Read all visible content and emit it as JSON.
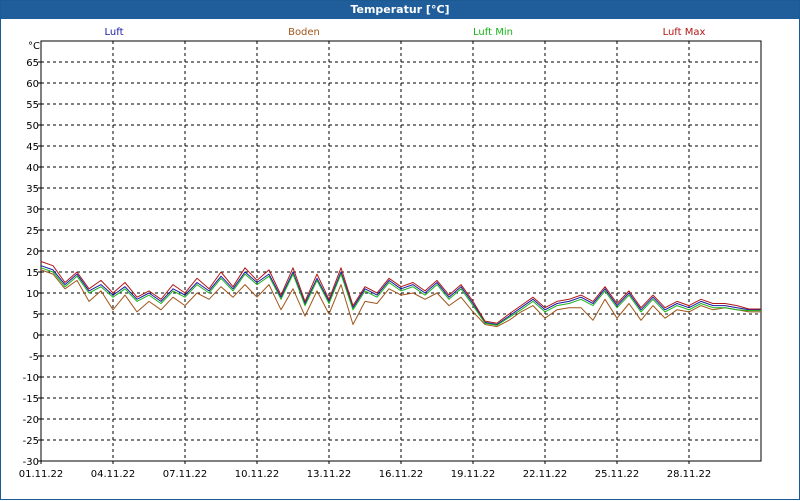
{
  "window": {
    "title": "Temperatur [°C]"
  },
  "chart_data": {
    "type": "line",
    "title": "Temperatur [°C]",
    "ylabel": "°C",
    "xlabel": "",
    "ylim": [
      -30,
      70
    ],
    "yticks": [
      65,
      60,
      55,
      50,
      45,
      40,
      35,
      30,
      25,
      20,
      15,
      10,
      5,
      0,
      -5,
      -10,
      -15,
      -20,
      -25,
      -30
    ],
    "x_tick_labels": [
      "01.11.22",
      "04.11.22",
      "07.11.22",
      "10.11.22",
      "13.11.22",
      "16.11.22",
      "19.11.22",
      "22.11.22",
      "25.11.22",
      "28.11.22"
    ],
    "x_tick_days": [
      0,
      3,
      6,
      9,
      12,
      15,
      18,
      21,
      24,
      27
    ],
    "x_range_days": [
      0,
      30
    ],
    "grid": true,
    "legend_placement": "top",
    "days": [
      0,
      0.5,
      1,
      1.5,
      2,
      2.5,
      3,
      3.5,
      4,
      4.5,
      5,
      5.5,
      6,
      6.5,
      7,
      7.5,
      8,
      8.5,
      9,
      9.5,
      10,
      10.5,
      11,
      11.5,
      12,
      12.5,
      13,
      13.5,
      14,
      14.5,
      15,
      15.5,
      16,
      16.5,
      17,
      17.5,
      18,
      18.5,
      19,
      19.5,
      20,
      20.5,
      21,
      21.5,
      22,
      22.5,
      23,
      23.5,
      24,
      24.5,
      25,
      25.5,
      26,
      26.5,
      27,
      27.5,
      28,
      28.5,
      29,
      29.5,
      30
    ],
    "series": [
      {
        "name": "Luft",
        "color": "#1a1aa8",
        "values": [
          16.5,
          15.5,
          12.0,
          14.5,
          10.5,
          12.0,
          9.5,
          11.5,
          8.5,
          10.0,
          8.0,
          11.0,
          9.5,
          12.5,
          10.5,
          14.0,
          11.0,
          15.0,
          12.5,
          14.5,
          9.0,
          15.0,
          7.5,
          13.5,
          8.0,
          15.0,
          6.5,
          11.0,
          9.5,
          13.0,
          11.0,
          12.0,
          10.0,
          12.5,
          9.0,
          11.5,
          7.5,
          3.0,
          2.5,
          4.5,
          6.5,
          8.5,
          6.0,
          7.5,
          8.0,
          9.0,
          7.5,
          11.0,
          7.0,
          10.0,
          6.0,
          9.0,
          6.0,
          7.5,
          6.5,
          8.0,
          7.0,
          7.0,
          6.5,
          6.0,
          6.0
        ]
      },
      {
        "name": "Boden",
        "color": "#a0561c",
        "values": [
          15.5,
          14.5,
          11.0,
          13.0,
          8.0,
          10.5,
          6.0,
          9.5,
          5.5,
          8.0,
          6.0,
          9.0,
          7.0,
          10.0,
          8.5,
          11.5,
          9.0,
          12.0,
          9.0,
          12.0,
          6.0,
          11.0,
          4.5,
          10.5,
          5.0,
          12.0,
          2.5,
          8.0,
          7.5,
          11.0,
          9.5,
          10.0,
          8.5,
          10.0,
          7.0,
          9.0,
          5.5,
          2.5,
          2.0,
          3.5,
          5.5,
          7.0,
          4.0,
          6.0,
          6.5,
          6.5,
          3.5,
          8.5,
          4.0,
          7.5,
          3.5,
          7.0,
          4.0,
          6.0,
          5.5,
          7.0,
          6.0,
          6.5,
          6.0,
          5.5,
          5.5
        ]
      },
      {
        "name": "Luft Min",
        "color": "#19b519",
        "values": [
          16.0,
          15.0,
          11.5,
          14.0,
          10.0,
          11.5,
          9.0,
          11.0,
          8.0,
          9.5,
          7.5,
          10.5,
          9.0,
          12.0,
          10.0,
          13.5,
          10.5,
          14.5,
          12.0,
          14.0,
          8.5,
          14.5,
          7.0,
          13.0,
          7.5,
          14.5,
          6.0,
          10.5,
          9.0,
          12.5,
          10.5,
          11.5,
          9.5,
          12.0,
          8.5,
          11.0,
          7.0,
          2.8,
          2.3,
          4.2,
          6.0,
          8.0,
          5.5,
          7.0,
          7.5,
          8.5,
          7.0,
          10.5,
          6.5,
          9.5,
          5.5,
          8.5,
          5.5,
          7.0,
          6.0,
          7.5,
          6.5,
          6.5,
          6.0,
          5.8,
          5.8
        ]
      },
      {
        "name": "Luft Max",
        "color": "#b01818",
        "values": [
          17.5,
          16.5,
          12.5,
          15.0,
          11.0,
          13.0,
          10.0,
          12.5,
          9.0,
          10.5,
          8.5,
          12.0,
          10.0,
          13.5,
          11.0,
          15.0,
          11.5,
          16.0,
          13.0,
          15.5,
          9.5,
          16.0,
          8.0,
          14.5,
          8.5,
          16.0,
          7.0,
          11.5,
          10.0,
          13.5,
          11.5,
          12.5,
          10.5,
          13.0,
          9.5,
          12.0,
          8.0,
          3.3,
          2.8,
          5.0,
          7.0,
          9.0,
          6.5,
          8.0,
          8.5,
          9.5,
          8.0,
          11.5,
          7.5,
          10.5,
          6.5,
          9.5,
          6.5,
          8.0,
          7.0,
          8.5,
          7.5,
          7.5,
          7.0,
          6.2,
          6.2
        ]
      }
    ]
  }
}
